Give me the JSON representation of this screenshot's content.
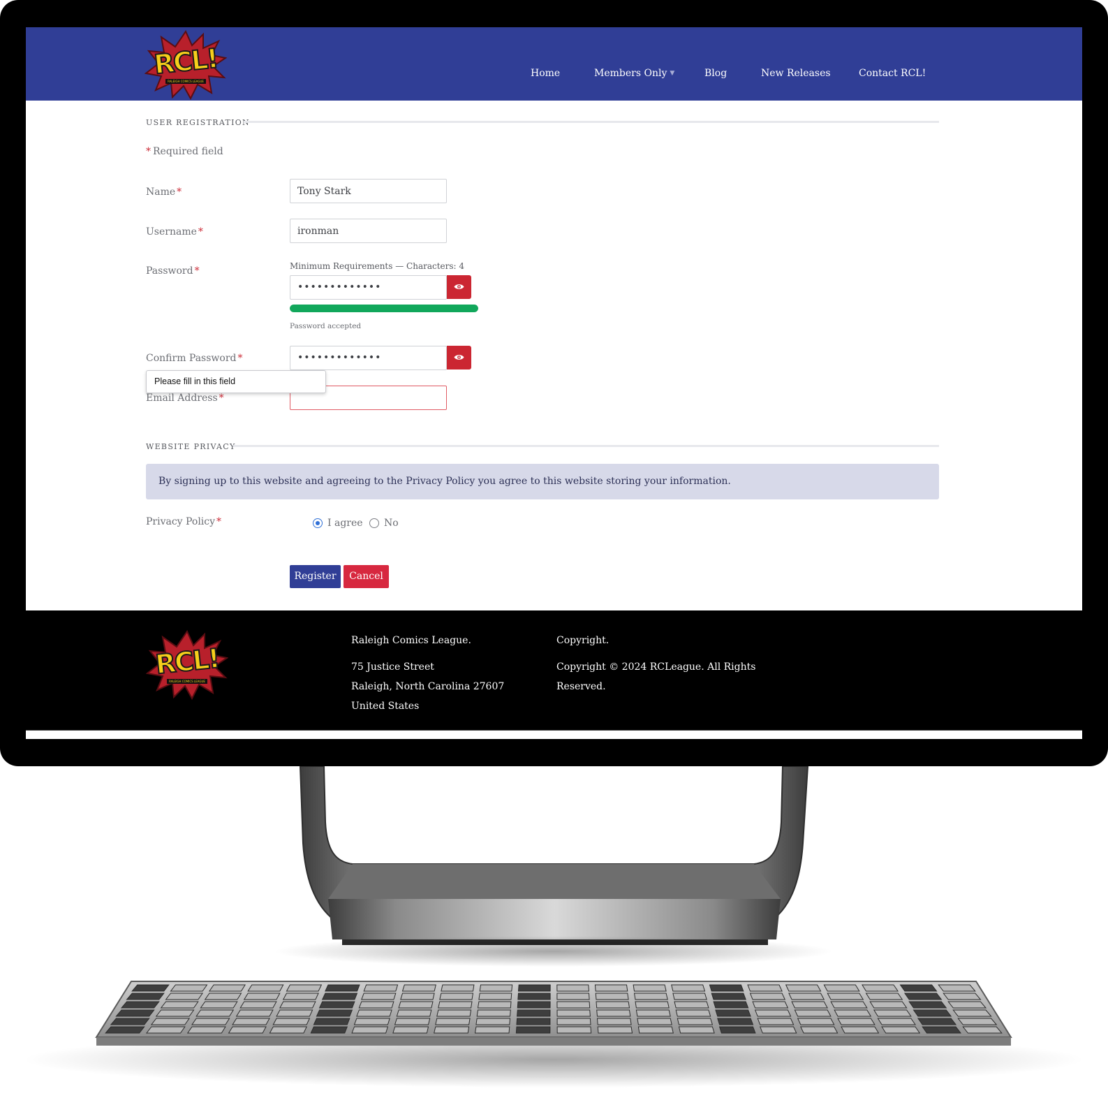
{
  "header": {
    "logo_text": "RCL!",
    "logo_subtext": "RALEIGH COMICS LEAGUE",
    "nav": [
      {
        "label": "Home"
      },
      {
        "label": "Members Only"
      },
      {
        "label": "Blog"
      },
      {
        "label": "New Releases"
      },
      {
        "label": "Contact RCL!"
      }
    ]
  },
  "registration": {
    "section_title": "USER REGISTRATION",
    "required_note": "Required field",
    "required_marker": "*",
    "fields": {
      "name": {
        "label": "Name",
        "value": "Tony Stark"
      },
      "username": {
        "label": "Username",
        "value": "ironman"
      },
      "password": {
        "label": "Password",
        "value": "•••••••••••••",
        "requirements": "Minimum Requirements — Characters: 4",
        "strength_fraction": 1.0,
        "status": "Password accepted"
      },
      "confirm_password": {
        "label": "Confirm Password",
        "value": "•••••••••••••"
      },
      "email": {
        "label": "Email Address",
        "value": ""
      }
    },
    "validation_tooltip": "Please fill in this field"
  },
  "privacy": {
    "section_title": "WEBSITE PRIVACY",
    "notice": "By signing up to this website and agreeing to the Privacy Policy you agree to this website storing your information.",
    "label": "Privacy Policy",
    "options": [
      {
        "label": "I agree",
        "selected": true
      },
      {
        "label": "No",
        "selected": false
      }
    ]
  },
  "actions": {
    "register_label": "Register",
    "cancel_label": "Cancel"
  },
  "footer": {
    "org_title": "Raleigh Comics League.",
    "address": [
      "75 Justice Street",
      "Raleigh, North Carolina 27607",
      "United States"
    ],
    "copyright_title": "Copyright.",
    "copyright_lines": [
      "Copyright © 2024 RCLeague. All Rights",
      "Reserved."
    ]
  },
  "colors": {
    "header_bg": "#303e96",
    "accent_red": "#cb2632",
    "cancel_red": "#d7283f",
    "strength_green": "#11a75b",
    "notice_bg": "#d7d9e9",
    "footer_bg": "#000000"
  }
}
